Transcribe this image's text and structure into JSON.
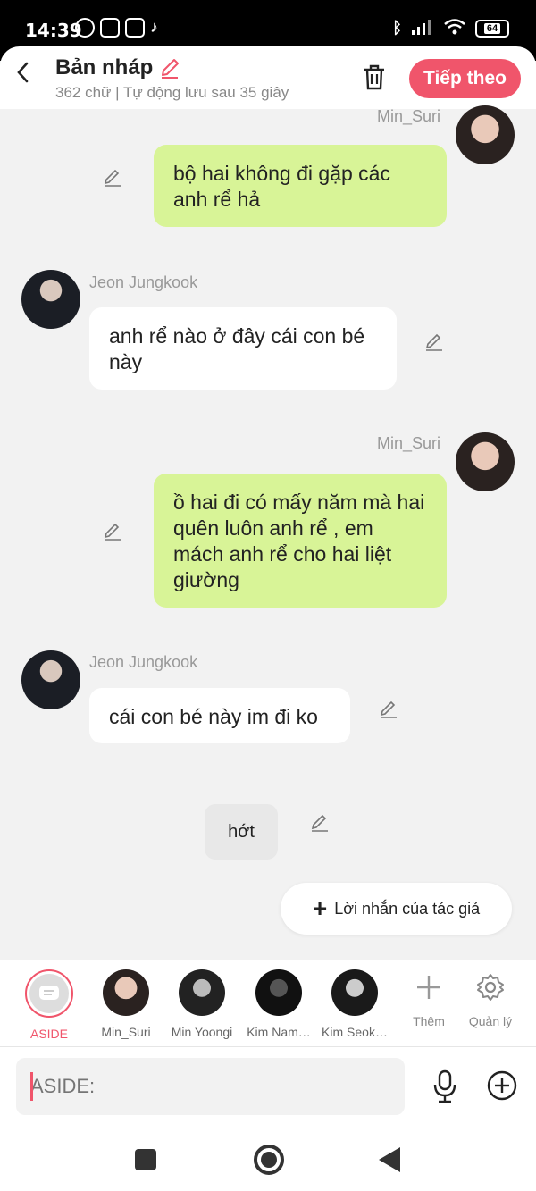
{
  "status_bar": {
    "time": "14:39",
    "battery": "64"
  },
  "header": {
    "title": "Bản nháp",
    "subtitle": "362 chữ | Tự động lưu sau 35 giây",
    "next_button": "Tiếp theo"
  },
  "chat": [
    {
      "sender": "Min_Suri",
      "side": "right",
      "text": "bộ hai không đi gặp các anh rể hả"
    },
    {
      "sender": "Jeon Jungkook",
      "side": "left",
      "text": "anh rể nào ở đây cái con bé này"
    },
    {
      "sender": "Min_Suri",
      "side": "right",
      "text": "ồ hai đi có mấy năm mà hai quên luôn anh rể , em mách anh rể cho hai liệt giường"
    },
    {
      "sender": "Jeon Jungkook",
      "side": "left",
      "text": "cái con bé này im đi ko"
    },
    {
      "sender": "",
      "side": "center",
      "text": "hớt"
    }
  ],
  "author_message_button": "Lời nhắn của tác giả",
  "characters": [
    {
      "label": "ASIDE",
      "active": true
    },
    {
      "label": "Min_Suri"
    },
    {
      "label": "Min Yoongi"
    },
    {
      "label": "Kim Nam…"
    },
    {
      "label": "Kim Seok…"
    }
  ],
  "tools": {
    "add": "Thêm",
    "manage": "Quản lý"
  },
  "input": {
    "placeholder": "ASIDE:"
  },
  "colors": {
    "accent": "#f0556b",
    "my_bubble": "#d8f497",
    "other_bubble": "#ffffff"
  }
}
